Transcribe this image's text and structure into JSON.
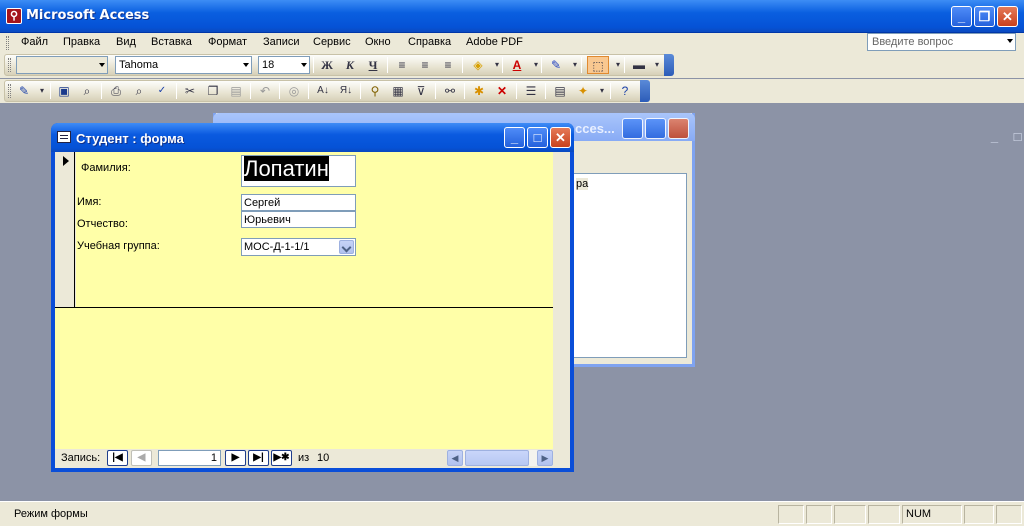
{
  "app": {
    "title": "Microsoft Access"
  },
  "menu": {
    "items": [
      "Файл",
      "Правка",
      "Вид",
      "Вставка",
      "Формат",
      "Записи",
      "Сервис",
      "Окно",
      "Справка",
      "Adobe PDF"
    ],
    "help_placeholder": "Введите вопрос"
  },
  "formatting_toolbar": {
    "object_combo": "",
    "font_name": "Tahoma",
    "font_size": "18"
  },
  "background_window": {
    "title_fragment": "cces...",
    "text_fragment": "ра"
  },
  "form_window": {
    "title": "Студент : форма",
    "fields": {
      "surname_label": "Фамилия:",
      "surname_value": "Лопатин",
      "name_label": "Имя:",
      "name_value": "Сергей",
      "patronymic_label": "Отчество:",
      "patronymic_value": "Юрьевич",
      "group_label": "Учебная группа:",
      "group_value": "МОС-Д-1-1/1"
    },
    "nav": {
      "record_label": "Запись:",
      "current": "1",
      "of_label": "из",
      "total": "10"
    }
  },
  "statusbar": {
    "mode": "Режим формы",
    "num": "NUM"
  }
}
